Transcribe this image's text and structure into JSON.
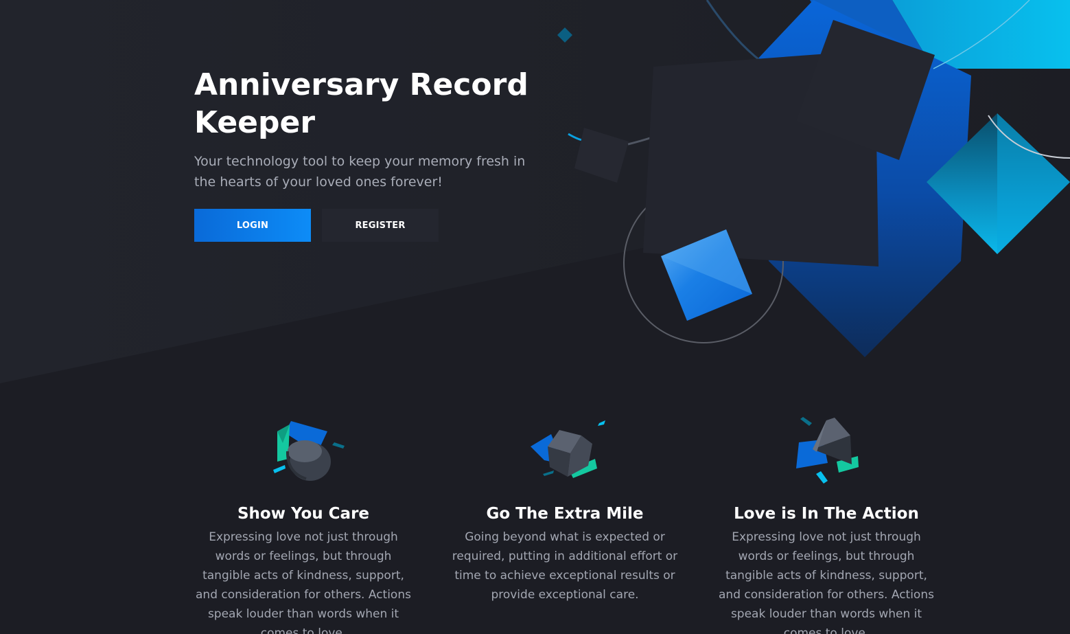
{
  "hero": {
    "title": "Anniversary Record Keeper",
    "subtitle": "Your technology tool to keep your memory fresh in the hearts of your loved ones forever!",
    "login_label": "LOGIN",
    "register_label": "REGISTER"
  },
  "features": [
    {
      "icon": "cylinder-shape-icon",
      "title": "Show You Care",
      "text": "Expressing love not just through words or feelings, but through tangible acts of kindness, support, and consideration for others. Actions speak louder than words when it comes to love."
    },
    {
      "icon": "cube-shape-icon",
      "title": "Go The Extra Mile",
      "text": "Going beyond what is expected or required, putting in additional effort or time to achieve exceptional results or provide exceptional care."
    },
    {
      "icon": "pyramid-shape-icon",
      "title": "Love is In The Action",
      "text": "Expressing love not just through words or feelings, but through tangible acts of kindness, support, and consideration for others. Actions speak louder than words when it comes to love."
    }
  ],
  "colors": {
    "background": "#1c1d24",
    "accent": "#0d8cf7",
    "cyan": "#06b6e6",
    "teal": "#14c8a0"
  }
}
